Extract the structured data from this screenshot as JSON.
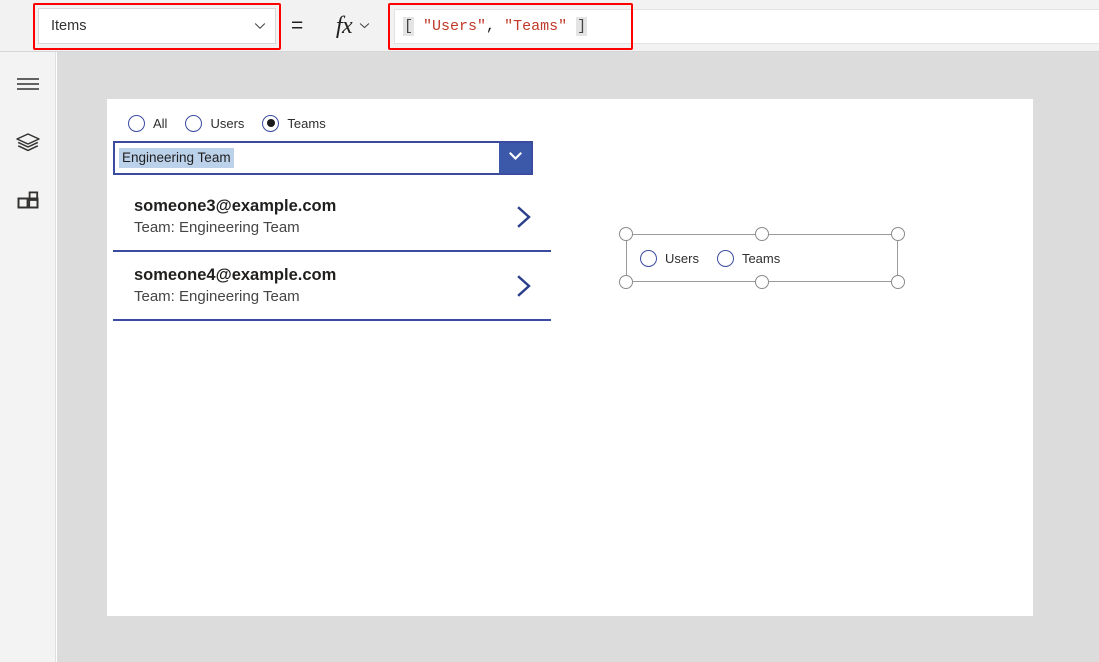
{
  "toolbar": {
    "property_dropdown": {
      "value": "Items",
      "chevron_icon": "chevron-down-icon"
    },
    "equals": "=",
    "fx": {
      "glyph": "fx",
      "chevron_icon": "chevron-down-icon"
    },
    "formula": {
      "open_bracket": "[",
      "space_after_open": " ",
      "string1": "\"Users\"",
      "comma": ",",
      "space_mid": " ",
      "string2": "\"Teams\"",
      "space_before_close": " ",
      "close_bracket": "]",
      "full_text": "[ \"Users\", \"Teams\" ]"
    },
    "annotations": {
      "highlight_color": "#ff0000",
      "boxes": [
        "property-dropdown",
        "formula-input"
      ]
    }
  },
  "left_rail": {
    "items": [
      {
        "name": "hamburger-menu",
        "label": "Menu"
      },
      {
        "name": "tree-view",
        "label": "Tree view"
      },
      {
        "name": "insert-components",
        "label": "Insert"
      }
    ]
  },
  "canvas": {
    "background_color": "#dcdcdc",
    "screen_background": "#ffffff",
    "radio_group": {
      "name": "filter-radio-group",
      "options": [
        {
          "label": "All",
          "selected": false
        },
        {
          "label": "Users",
          "selected": false
        },
        {
          "label": "Teams",
          "selected": true
        }
      ]
    },
    "combobox": {
      "name": "team-combobox",
      "value": "Engineering Team",
      "selection_highlight": "#bcd1ea",
      "border_color": "#3b4ba0",
      "arrow_icon": "chevron-down-icon"
    },
    "gallery": {
      "name": "people-gallery",
      "items": [
        {
          "title": "someone3@example.com",
          "subtitle": "Team: Engineering Team",
          "chevron_icon": "chevron-right-icon"
        },
        {
          "title": "someone4@example.com",
          "subtitle": "Team: Engineering Team",
          "chevron_icon": "chevron-right-icon"
        }
      ]
    },
    "selected_control": {
      "name": "source-radio-control",
      "options": [
        {
          "label": "Users",
          "selected": false
        },
        {
          "label": "Teams",
          "selected": false
        }
      ],
      "handles": [
        "top-left",
        "top-center",
        "top-right",
        "bottom-left",
        "bottom-center",
        "bottom-right"
      ]
    }
  },
  "colors": {
    "accent_blue": "#3b4ba0",
    "combobox_arrow_blue": "#3b59a8",
    "formula_string_red": "#c0392b",
    "annotation_red": "#ff0000",
    "canvas_gray": "#dcdcdc",
    "rail_gray": "#f3f3f3"
  }
}
